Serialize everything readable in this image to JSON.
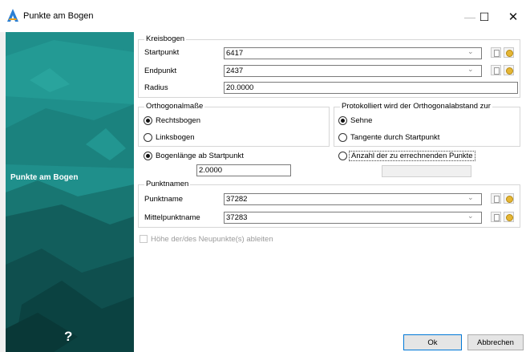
{
  "window": {
    "title": "Punkte am Bogen",
    "minimize_glyph": "—",
    "maximize_glyph": "☐",
    "close_glyph": "✕"
  },
  "sidebar": {
    "title": "Punkte am Bogen",
    "help_glyph": "?",
    "background_color": "#22928e"
  },
  "kreisbogen": {
    "legend": "Kreisbogen",
    "start_label": "Startpunkt",
    "start_value": "6417",
    "end_label": "Endpunkt",
    "end_value": "2437",
    "radius_label": "Radius",
    "radius_value": "20.0000",
    "arrow_glyph": "⌄"
  },
  "orthogonal": {
    "legend": "Orthogonalmaße",
    "options": [
      "Rechtsbogen",
      "Linksbogen"
    ],
    "selected": "Rechtsbogen"
  },
  "protokoll": {
    "legend": "Protokolliert wird der Orthogonalabstand zur",
    "options": [
      "Sehne",
      "Tangente durch Startpunkt"
    ],
    "selected": "Sehne"
  },
  "mode": {
    "arc_length_label": "Bogenlänge ab Startpunkt",
    "arc_length_value": "2.0000",
    "count_label": "Anzahl der zu errechnenden Punkte",
    "count_value": ""
  },
  "punktnamen": {
    "legend": "Punktnamen",
    "name_label": "Punktname",
    "name_value": "37282",
    "mid_label": "Mittelpunktname",
    "mid_value": "37283"
  },
  "hoehe_checkbox": {
    "label": "Höhe der/des Neupunkte(s) ableiten",
    "checked": false
  },
  "buttons": {
    "ok": "Ok",
    "cancel": "Abbrechen"
  }
}
